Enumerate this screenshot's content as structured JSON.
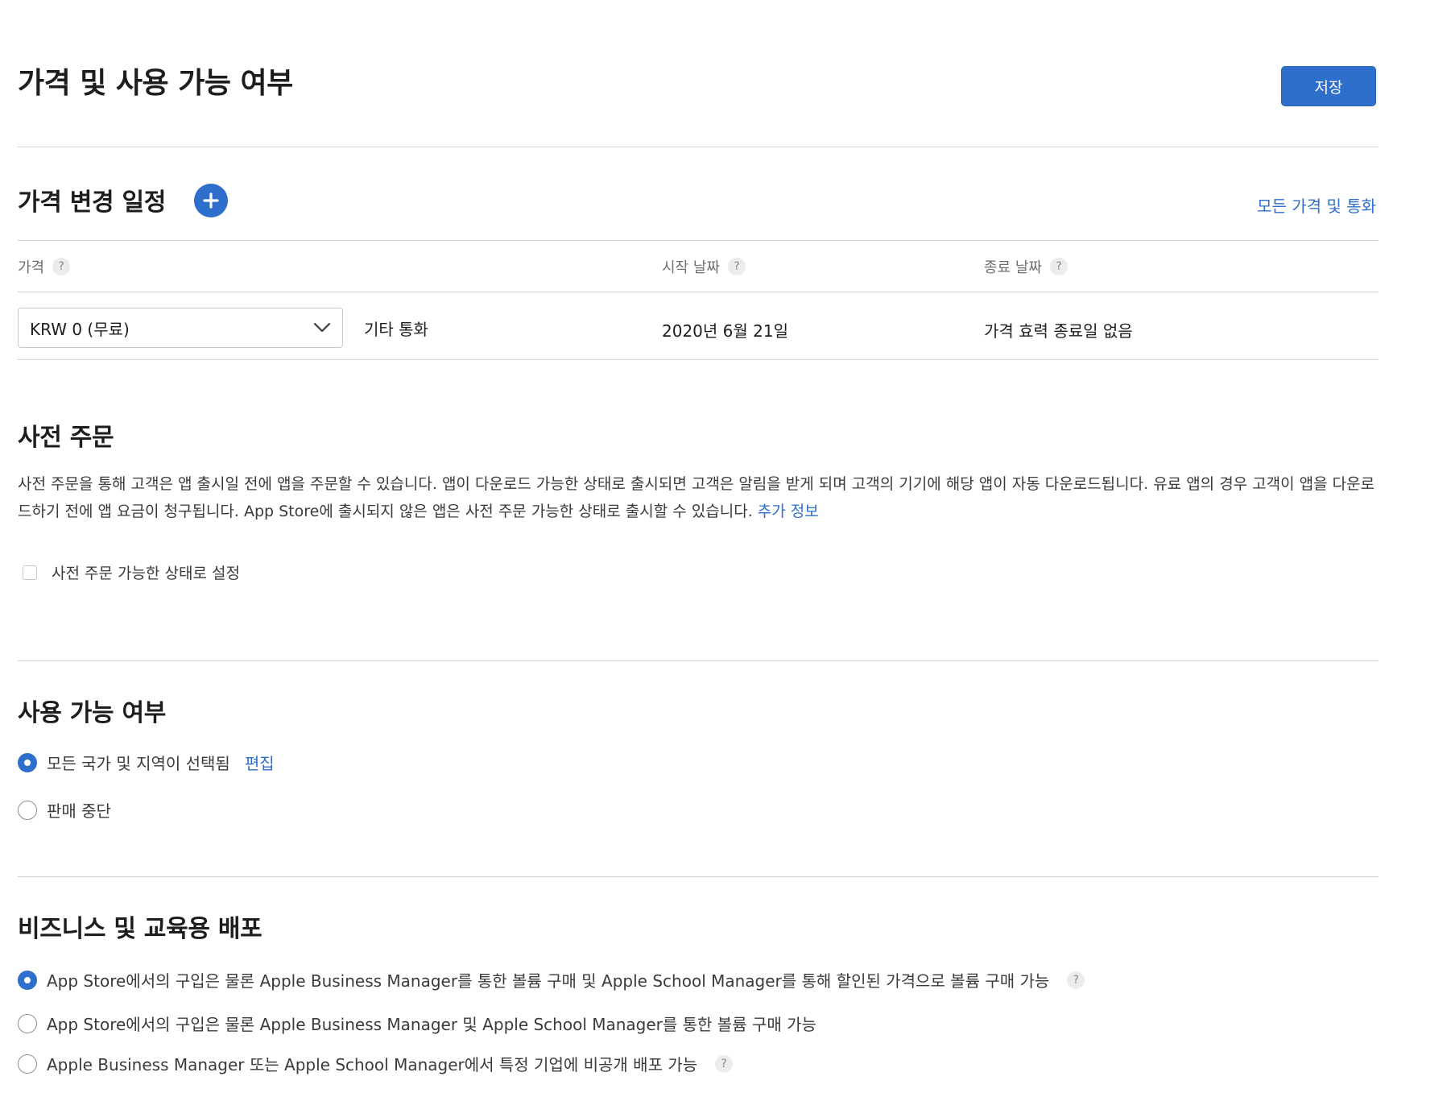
{
  "header": {
    "title": "가격 및 사용 가능 여부",
    "save_label": "저장"
  },
  "price_schedule": {
    "title": "가격 변경 일정",
    "add_icon": "plus-circle-icon",
    "all_prices_link": "모든 가격 및 통화",
    "columns": {
      "price": "가격",
      "start_date": "시작 날짜",
      "end_date": "종료 날짜"
    },
    "help_glyph": "?",
    "row": {
      "price_value": "KRW 0 (무료)",
      "other_currency_link": "기타 통화",
      "start_date": "2020년 6월 21일",
      "end_date": "가격 효력 종료일 없음"
    }
  },
  "preorder": {
    "title": "사전 주문",
    "description": "사전 주문을 통해 고객은 앱 출시일 전에 앱을 주문할 수 있습니다. 앱이 다운로드 가능한 상태로 출시되면 고객은 알림을 받게 되며 고객의 기기에 해당 앱이 자동 다운로드됩니다. 유료 앱의 경우 고객이 앱을 다운로드하기 전에 앱 요금이 청구됩니다. App Store에 출시되지 않은 앱은 사전 주문 가능한 상태로 출시할 수 있습니다.",
    "more_info_link": "추가 정보",
    "checkbox_label": "사전 주문 가능한 상태로 설정",
    "checked": false
  },
  "availability": {
    "title": "사용 가능 여부",
    "options": [
      {
        "label": "모든 국가 및 지역이 선택됨",
        "selected": true
      },
      {
        "label": "판매 중단",
        "selected": false
      }
    ],
    "edit_link": "편집"
  },
  "distribution": {
    "title": "비즈니스 및 교육용 배포",
    "options": [
      {
        "label": "App Store에서의 구입은 물론 Apple Business Manager를 통한 볼륨 구매 및 Apple School Manager를 통해 할인된 가격으로 볼륨 구매 가능",
        "selected": true
      },
      {
        "label": "App Store에서의 구입은 물론 Apple Business Manager 및 Apple School Manager를 통한 볼륨 구매 가능",
        "selected": false
      },
      {
        "label": "Apple Business Manager 또는 Apple School Manager에서 특정 기업에 비공개 배포 가능",
        "selected": false
      }
    ]
  },
  "colors": {
    "accent": "#2f6fcc",
    "divider": "#d2d2d7",
    "text": "#1d1d1f"
  }
}
